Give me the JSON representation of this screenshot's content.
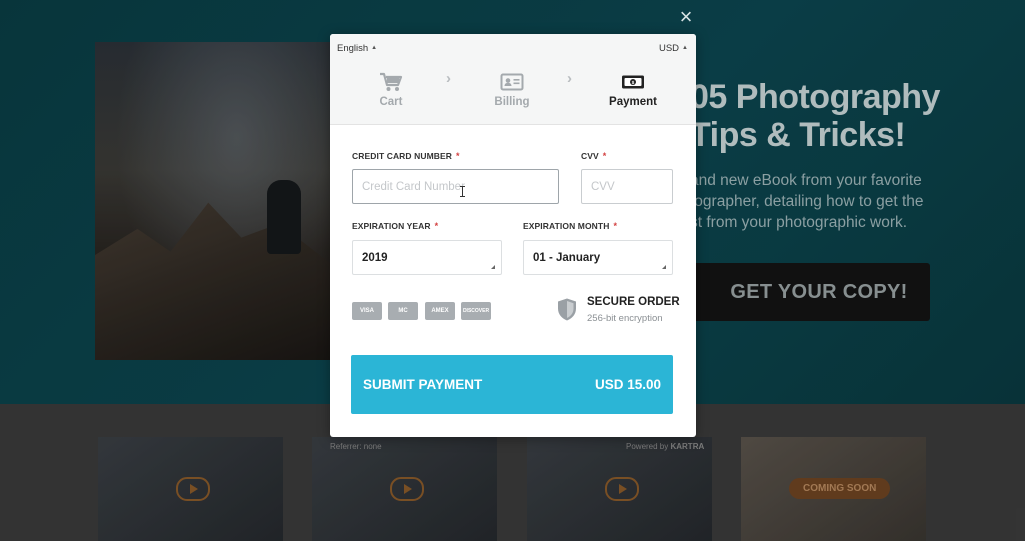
{
  "background": {
    "hero_title": [
      "05 Photography",
      "Tips & Tricks!"
    ],
    "hero_description": [
      "and new eBook from your favorite",
      "tographer, detailing how to get the",
      "st from your photographic work."
    ],
    "cta_label": "GET YOUR COPY!",
    "coming_soon": "COMING SOON",
    "referrer_text": "Referrer: none",
    "powered_by_prefix": "Powered by ",
    "powered_by_brand": "KARTRA"
  },
  "modal": {
    "close_symbol": "×",
    "language": "English",
    "currency": "USD",
    "steps": [
      {
        "label": "Cart",
        "icon": "cart-icon",
        "active": false
      },
      {
        "label": "Billing",
        "icon": "id-card-icon",
        "active": false
      },
      {
        "label": "Payment",
        "icon": "money-icon",
        "active": true
      }
    ],
    "step_chevron": "›",
    "fields": {
      "card_number_label": "CREDIT CARD NUMBER",
      "card_number_placeholder": "Credit Card Number",
      "cvv_label": "CVV",
      "cvv_placeholder": "CVV",
      "exp_year_label": "EXPIRATION YEAR",
      "exp_year_value": "2019",
      "exp_month_label": "EXPIRATION MONTH",
      "exp_month_value": "01 - January",
      "required_mark": "*"
    },
    "cards": [
      "VISA",
      "MC",
      "AMEX",
      "DISCOVER"
    ],
    "secure": {
      "title": "SECURE ORDER",
      "subtitle": "256-bit encryption"
    },
    "submit": {
      "label": "SUBMIT PAYMENT",
      "amount": "USD 15.00"
    },
    "accent_color": "#2bb5d6",
    "required_color": "#d34141"
  }
}
